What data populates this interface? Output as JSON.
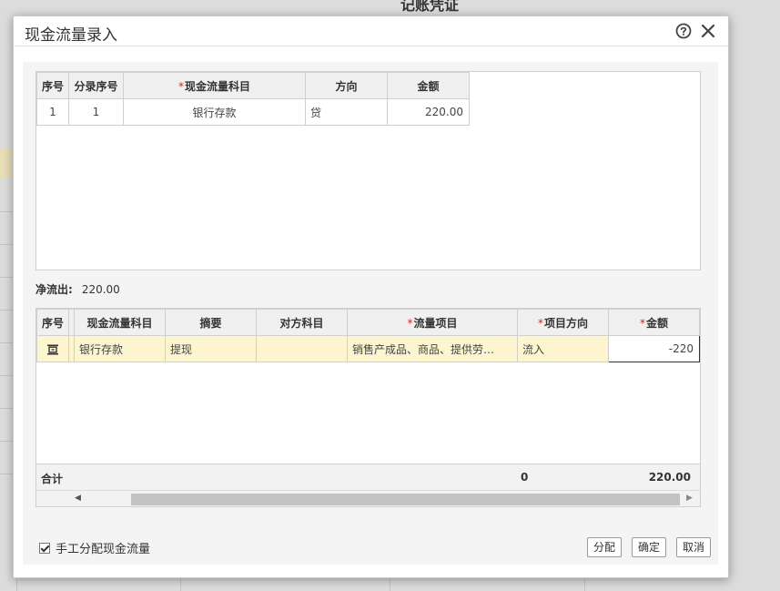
{
  "background": {
    "title": "记账凭证"
  },
  "dialog": {
    "title": "现金流量录入",
    "help_icon": "question-circle-icon",
    "close_icon": "close-icon"
  },
  "entry_table": {
    "headers": {
      "seq": "序号",
      "entry_seq": "分录序号",
      "account": "现金流量科目",
      "direction": "方向",
      "amount": "金额"
    },
    "required_mark": "*",
    "rows": [
      {
        "seq": "1",
        "entry_seq": "1",
        "account": "银行存款",
        "direction": "贷",
        "amount": "220.00"
      }
    ]
  },
  "net_outflow": {
    "label": "净流出:",
    "value": "220.00"
  },
  "flow_table": {
    "headers": {
      "seq": "序号",
      "account": "现金流量科目",
      "summary": "摘要",
      "counter_account": "对方科目",
      "flow_item": "流量项目",
      "item_direction": "项目方向",
      "amount": "金额"
    },
    "required_mark": "*",
    "rows": [
      {
        "account": "银行存款",
        "summary": "提现",
        "counter_account": "",
        "flow_item": "销售产成品、商品、提供劳…",
        "item_direction": "流入",
        "amount": "-220"
      }
    ],
    "total": {
      "label": "合计",
      "zero": "0",
      "value": "220.00"
    }
  },
  "footer": {
    "manual_checkbox_label": "手工分配现金流量",
    "manual_checked": true,
    "allocate_button": "分配",
    "confirm_button": "确定",
    "cancel_button": "取消"
  }
}
